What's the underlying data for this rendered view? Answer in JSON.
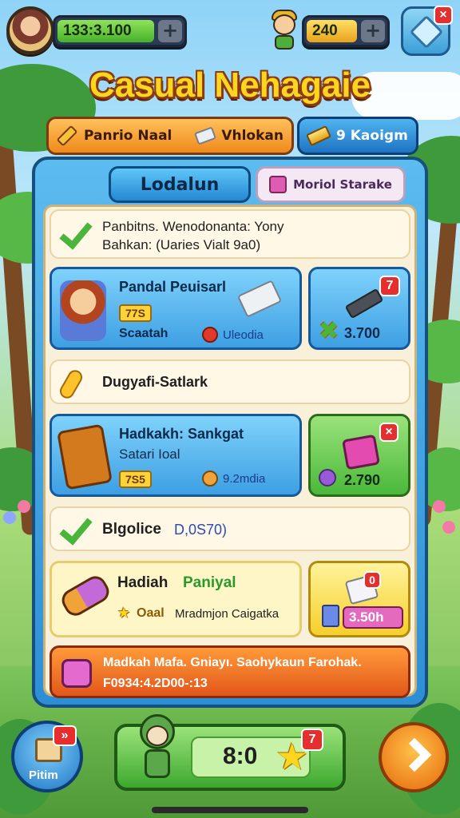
{
  "top_bar": {
    "resource_1": "133:3.100",
    "resource_2": "240",
    "plus_1": "+",
    "plus_2": "+",
    "cube_badge": "×"
  },
  "title": "Casual Nehagaie",
  "tabs": [
    {
      "label": "Panrio Naal"
    },
    {
      "label": "Vhlokan"
    },
    {
      "label": "9 Kaoigm"
    }
  ],
  "subtabs": {
    "active": "Lodalun",
    "inactive": "Moriol Starake"
  },
  "rows": {
    "notice": {
      "line1": "Panbitns. Wenodonanta: Yony",
      "line2": "Bahkan: (Uaries Vialt 9a0)"
    },
    "card1": {
      "title": "Pandal Peuisarl",
      "chip": "77S",
      "label": "Scaatah",
      "sub": "Uleodia",
      "side_value": "3.700",
      "side_badge": "7"
    },
    "section1": "Dugyafi-Satlark",
    "card2": {
      "title": "Hadkakh: Sankgat",
      "subtitle": "Satari Ioal",
      "chip": "7S5",
      "sub": "9.2mdia",
      "side_value": "2.790",
      "side_badge": "×"
    },
    "section2": {
      "label": "Blgolice",
      "value": "D,0S70)"
    },
    "card3": {
      "title_a": "Hadiah",
      "title_b": "Paniyal",
      "chip_star": "★",
      "label_a": "Oaal",
      "label_b": "Mradmjon Caigatka",
      "side_value": "3.50h",
      "side_badge": "0"
    },
    "banner": {
      "line1": "Madkah Mafa. Gniayı. Saohykaun Farohak.",
      "line2": "F0934:4.2D00-:13"
    }
  },
  "bottom": {
    "left_label": "Pitim",
    "left_badge": "»",
    "mid_value": "8:0",
    "mid_badge": "7"
  },
  "colors": {
    "title": "#ffd51f",
    "panel": "#2d8ed6",
    "accent_orange": "#f08a1c",
    "accent_green": "#4ab83a",
    "badge_red": "#e52e2e"
  },
  "icons": [
    "avatar",
    "hero-icon",
    "cube-icon",
    "pencil-icon",
    "eraser-icon",
    "goldbar-icon",
    "checkmark-icon",
    "star-icon",
    "arrow-right-icon"
  ]
}
